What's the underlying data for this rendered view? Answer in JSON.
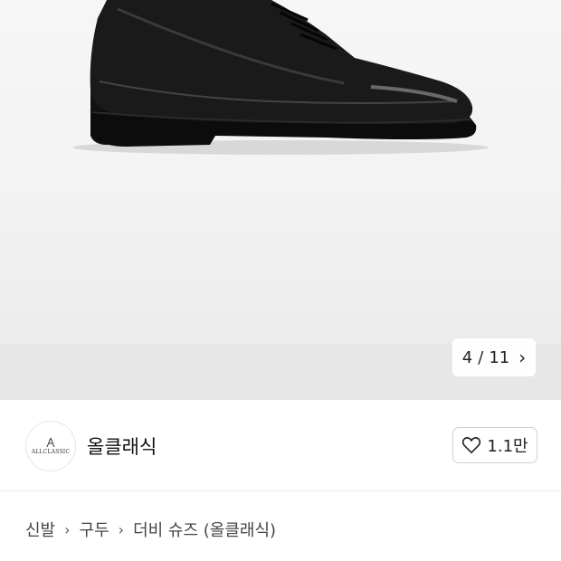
{
  "gallery": {
    "current": "4",
    "separator": "/",
    "total": "11"
  },
  "seller": {
    "logo_text": "ALLCLASSIC",
    "name": "올클래식"
  },
  "follow": {
    "count": "1.1만"
  },
  "breadcrumb": {
    "items": [
      "신발",
      "구두",
      "더비 슈즈 (올클래식)"
    ]
  },
  "icons": {
    "next": "chevron-right-icon",
    "like": "heart-outline-icon",
    "breadcrumb_separator": "chevron-right-icon"
  },
  "colors": {
    "image_background": "#f3f3f3",
    "text_primary": "#111111",
    "border": "#cfcfcf"
  }
}
